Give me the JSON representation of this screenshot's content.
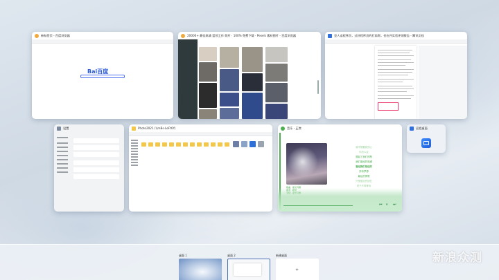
{
  "windows": {
    "browser1": {
      "title": "新标签页 - 百度浏览器",
      "logo": "Bai百度"
    },
    "browser2": {
      "title": "20000+ 最佳高清 蓝领工作 照片 · 100% 免费下载 · Pexels 素材图片 - 百度浏览器"
    },
    "browser3": {
      "title": "坚人谈程序员，过好程序员的打扇帮，也在开实验评测报告 - 腾讯文档"
    },
    "settings": {
      "title": "设置"
    },
    "explorer": {
      "title": "Photo2021 (\\\\mBs-LeFtOf)"
    },
    "music": {
      "title": "音乐 - 正常",
      "lyrics": [
        "我不想要我的心",
        "你怎么会",
        "想起了我们的歌",
        "我们曾经的相遇",
        "曾经我们相信的",
        "所有梦想",
        "最后的情歌",
        "只是彼此的回忆",
        "终于不再等待"
      ],
      "meta": [
        "歌曲：星光闪耀",
        "歌手：暖阳",
        "专辑：星光闪耀"
      ]
    },
    "remote": {
      "title": "远程桌面"
    }
  },
  "desktops": [
    {
      "label": "桌面 1"
    },
    {
      "label": "桌面 2"
    },
    {
      "label": "新建桌面",
      "plus": "+"
    }
  ],
  "watermark": "新浪众测",
  "colors": {
    "accent": "#4a6fb5",
    "music_green": "#4caf50",
    "folder": "#f3c74a"
  }
}
